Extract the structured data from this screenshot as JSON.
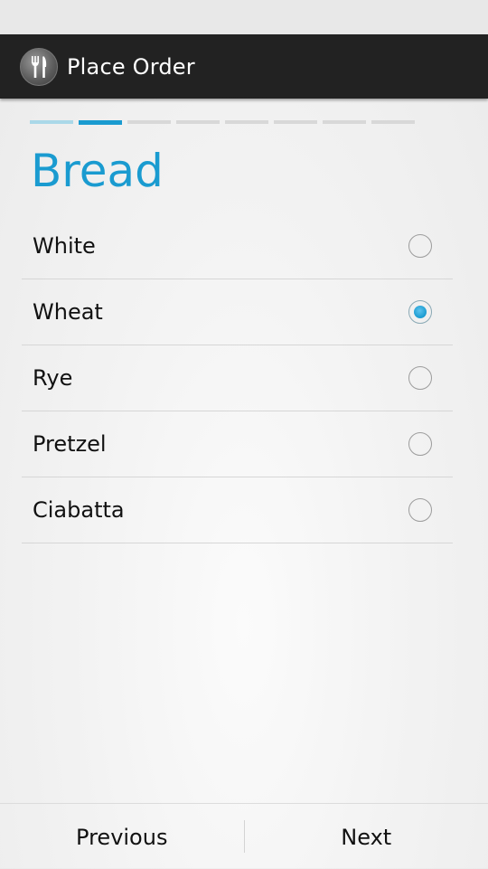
{
  "action_bar": {
    "title": "Place Order",
    "icon": "fork-knife-icon"
  },
  "progress": {
    "total_steps": 8,
    "current_step": 2
  },
  "section": {
    "title": "Bread"
  },
  "options": [
    {
      "label": "White",
      "selected": false
    },
    {
      "label": "Wheat",
      "selected": true
    },
    {
      "label": "Rye",
      "selected": false
    },
    {
      "label": "Pretzel",
      "selected": false
    },
    {
      "label": "Ciabatta",
      "selected": false
    }
  ],
  "nav": {
    "previous_label": "Previous",
    "next_label": "Next"
  },
  "colors": {
    "accent": "#1a9bd0",
    "action_bar": "#222222"
  }
}
